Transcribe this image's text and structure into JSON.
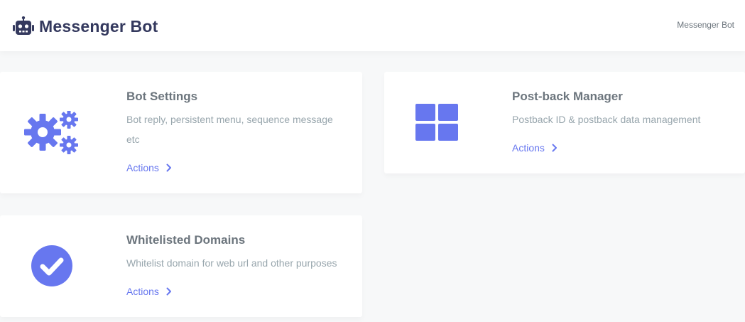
{
  "header": {
    "title": "Messenger Bot",
    "breadcrumb": "Messenger Bot",
    "icon": "robot-icon"
  },
  "colors": {
    "accent": "#6777ef",
    "title_text": "#34395e",
    "muted_text": "#98a6ad",
    "card_title": "#6c757d"
  },
  "cards": [
    {
      "icon": "gears-icon",
      "title": "Bot Settings",
      "description": "Bot reply, persistent menu, sequence message etc",
      "action": "Actions"
    },
    {
      "icon": "grid-icon",
      "title": "Post-back Manager",
      "description": "Postback ID & postback data management",
      "action": "Actions"
    },
    {
      "icon": "check-circle-icon",
      "title": "Whitelisted Domains",
      "description": "Whitelist domain for web url and other purposes",
      "action": "Actions"
    }
  ]
}
